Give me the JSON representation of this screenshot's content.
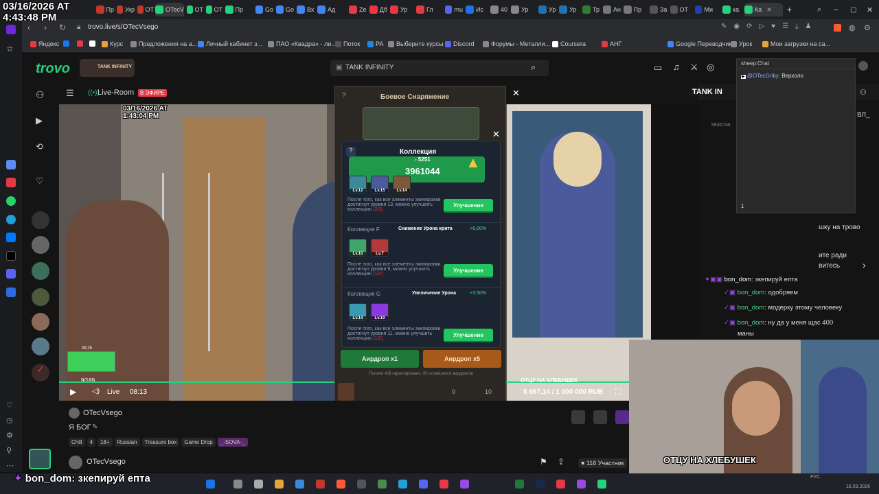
{
  "overlay": {
    "date": "03/16/2026 AT",
    "time": "4:43:48 PM",
    "video_date": "03/16/2026 AT",
    "video_time": "1:43:04 PM"
  },
  "browser": {
    "tabs": [
      "Пр",
      "Укр",
      "ОТ",
      "OTecV",
      "ОТ",
      "ОТ",
      "Пр",
      "Go",
      "Go",
      "Вх",
      "Ад",
      "Zе",
      "Дб",
      "Ур",
      "Гл",
      "mu",
      "Ис",
      "40",
      "Ур",
      "Ур",
      "Ур",
      "Тр",
      "Ан",
      "Пр",
      "За",
      "ОТ",
      "Ми",
      "ка",
      "Ка"
    ],
    "url": "trovo.live/s/OTecVsego",
    "bookmarks": [
      "Яндекс",
      "Курс",
      "Предложения на а...",
      "Личный кабинет з...",
      "ПАО «Квадра» - ли...",
      "Поток",
      "PA",
      "Выберите курсы",
      "Discord",
      "Форумы - Металли...",
      "Coursera",
      "АНГ",
      "Google Переводчик",
      "Урок",
      "Мои загрузки на са..."
    ]
  },
  "header": {
    "logo": "trovo",
    "category_badge": "TANK INFINITY",
    "search_value": "TANK INFINITY"
  },
  "stream": {
    "room_label": "Live-Room",
    "live_badge": "В ЭФИРЕ",
    "live_label": "Live",
    "elapsed": "08:13",
    "mini_time": "09:25",
    "viewers_counter": "9/189",
    "streamer": "OTecVsego",
    "title": "Я БОГ",
    "tags": [
      "Chill",
      "4",
      "18+",
      "Russian",
      "Treasure box",
      "Game Drop",
      "_-SOVA-_"
    ],
    "participants": "116 Участник",
    "goal_label": "ОТЦУ НА ХЛЕБУШЕК",
    "goal_progress": "5 667.14 / 1 000 000 RUB",
    "right_badge": "TANK IN"
  },
  "game": {
    "back_title": "Боевое Снаряжение",
    "panel_title": "Коллекция",
    "cost": "- 5251",
    "power": "3961044",
    "coll1": {
      "levels": [
        "Lv.12",
        "Lv.15",
        "Lv.14"
      ],
      "desc": "После того, как все элементы экипировки достигнут уровня 13, можно улучшить коллекцию",
      "progress": "(2/3)",
      "button": "Улучшение"
    },
    "coll2": {
      "name": "Коллекция F",
      "bonus_label": "Снижение Урона крита",
      "bonus_value": "+6.00%",
      "levels": [
        "Lv.10",
        "Lv.7"
      ],
      "desc": "После того, как все элементы экипировки достигнут уровня 9, можно улучшить коллекцию",
      "progress": "(1/2)",
      "button": "Улучшение"
    },
    "coll3": {
      "name": "Коллекция G",
      "bonus_label": "Увеличение Урона",
      "bonus_value": "+3.50%",
      "levels": [
        "Lv.14",
        "Lv.10"
      ],
      "desc": "После того, как все элементы экипировки достигнут уровня 11, можно улучшить коллекцию",
      "progress": "(1/2)",
      "button": "Улучшение"
    },
    "airdrop1": "Аирдроп x1",
    "airdrop5": "Аирдроп x5",
    "guarantee": "Полное А/В гарантировано: 95 оставшихся аирдропов",
    "count0": "0",
    "count10": "10",
    "help": "?"
  },
  "sheepchat": {
    "title": "sheep:Chat",
    "line_user": "@OTecGriby:",
    "line_text": "Верхоло",
    "minichat": "MiniChat",
    "count": "1"
  },
  "chat": {
    "partial1": "шку на трово",
    "partial2": "ите ради",
    "partial3": "витесь",
    "side_label": "ВЛ_",
    "messages": [
      {
        "user": "bon_dom",
        "text": "зкепируй епта"
      },
      {
        "user": "",
        "text": "одобряем"
      },
      {
        "user": "bon_dom",
        "text": "модерку этому человеку"
      },
      {
        "user": "bon_dom",
        "text": "ну да у меня щас 400"
      },
      {
        "user": "",
        "text": "маны"
      }
    ],
    "overlay_user": "bon_dom",
    "overlay_text": "зкепируй епта"
  },
  "taskbar": {
    "lang": "РУС",
    "date": "16.03.2026"
  }
}
